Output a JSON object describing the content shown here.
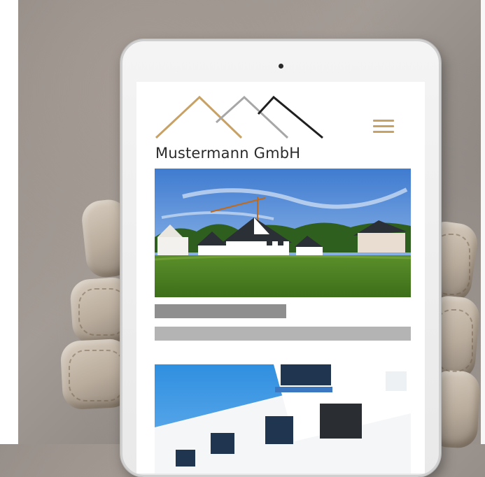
{
  "brand": {
    "name": "Mustermann GmbH",
    "logo_colors": [
      "#c8a165",
      "#a7a7a7",
      "#1f1f1f"
    ]
  },
  "header": {
    "menu_icon": "hamburger-menu-icon",
    "menu_color": "#c8a165"
  },
  "content": {
    "hero_image": "houses-construction-photo",
    "placeholder_bar_colors": [
      "#8f8f8f",
      "#b4b4b4"
    ],
    "second_image": "modern-apartment-building-photo"
  }
}
